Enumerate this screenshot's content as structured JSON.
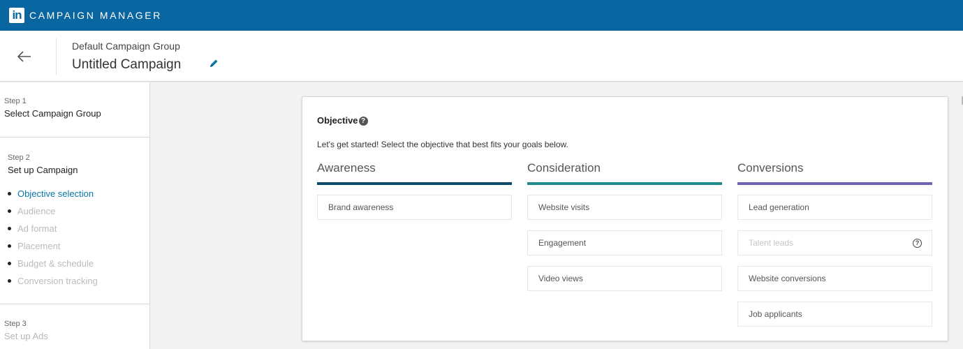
{
  "app": {
    "logo_text": "in",
    "title": "CAMPAIGN MANAGER",
    "brand_color": "#0a66a1"
  },
  "header": {
    "group_name": "Default Campaign Group",
    "campaign_name": "Untitled Campaign",
    "back_icon": "arrow-left-icon",
    "edit_icon": "pencil-icon"
  },
  "sidebar": {
    "steps": [
      {
        "number": "Step 1",
        "title": "Select Campaign Group"
      },
      {
        "number": "Step 2",
        "title": "Set up Campaign",
        "substeps": [
          {
            "label": "Objective selection",
            "active": true
          },
          {
            "label": "Audience",
            "active": false
          },
          {
            "label": "Ad format",
            "active": false
          },
          {
            "label": "Placement",
            "active": false
          },
          {
            "label": "Budget & schedule",
            "active": false
          },
          {
            "label": "Conversion tracking",
            "active": false
          }
        ]
      },
      {
        "number": "Step 3",
        "title": "Set up Ads"
      }
    ]
  },
  "objective": {
    "title": "Objective",
    "help_icon": "question-circle-icon",
    "description": "Let's get started! Select the objective that best fits your goals below.",
    "columns": [
      {
        "heading": "Awareness",
        "color": "#0e4a6b",
        "options": [
          {
            "label": "Brand awareness",
            "disabled": false
          }
        ]
      },
      {
        "heading": "Consideration",
        "color": "#1f8b8c",
        "options": [
          {
            "label": "Website visits",
            "disabled": false
          },
          {
            "label": "Engagement",
            "disabled": false
          },
          {
            "label": "Video views",
            "disabled": false
          }
        ]
      },
      {
        "heading": "Conversions",
        "color": "#6e63b5",
        "options": [
          {
            "label": "Lead generation",
            "disabled": false
          },
          {
            "label": "Talent leads",
            "disabled": true,
            "help_icon": "question-circle-outline-icon"
          },
          {
            "label": "Website conversions",
            "disabled": false
          },
          {
            "label": "Job applicants",
            "disabled": false
          }
        ]
      }
    ]
  }
}
